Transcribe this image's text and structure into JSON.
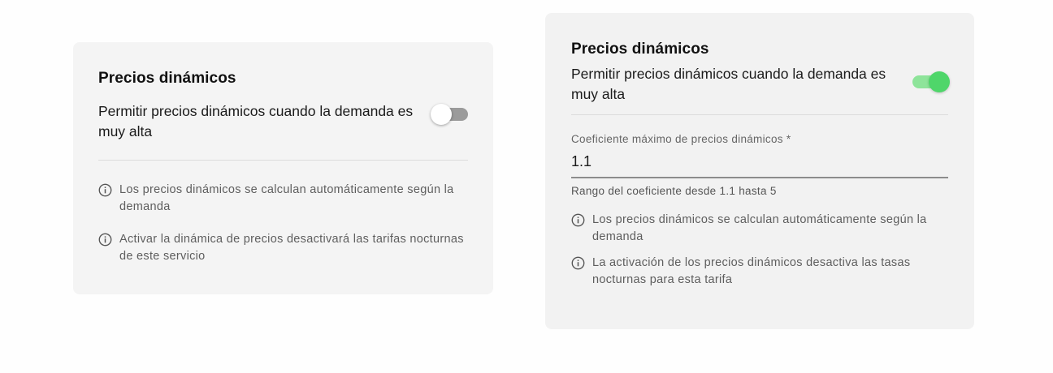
{
  "card_off": {
    "title": "Precios dinámicos",
    "toggle_label": "Permitir precios dinámicos cuando la demanda es muy alta",
    "toggle_on": false,
    "notes": [
      "Los precios dinámicos se calculan automáticamente según la demanda",
      "Activar la dinámica de precios desactivará las tarifas nocturnas de este servicio"
    ]
  },
  "card_on": {
    "title": "Precios dinámicos",
    "toggle_label": "Permitir precios dinámicos cuando la demanda es muy alta",
    "toggle_on": true,
    "field": {
      "label": "Coeficiente máximo de precios dinámicos *",
      "value": "1.1",
      "helper": "Rango del coeficiente desde 1.1 hasta 5"
    },
    "notes": [
      "Los precios dinámicos se calculan automáticamente según la demanda",
      "La activación de los precios dinámicos desactiva las tasas nocturnas para esta tarifa"
    ]
  },
  "colors": {
    "card_bg": "#f4f4f4",
    "toggle_on_thumb": "#4fd66a",
    "toggle_on_track": "#8ee49a",
    "toggle_off_track": "#9b9b9b"
  },
  "icons": {
    "note": "info-icon"
  }
}
